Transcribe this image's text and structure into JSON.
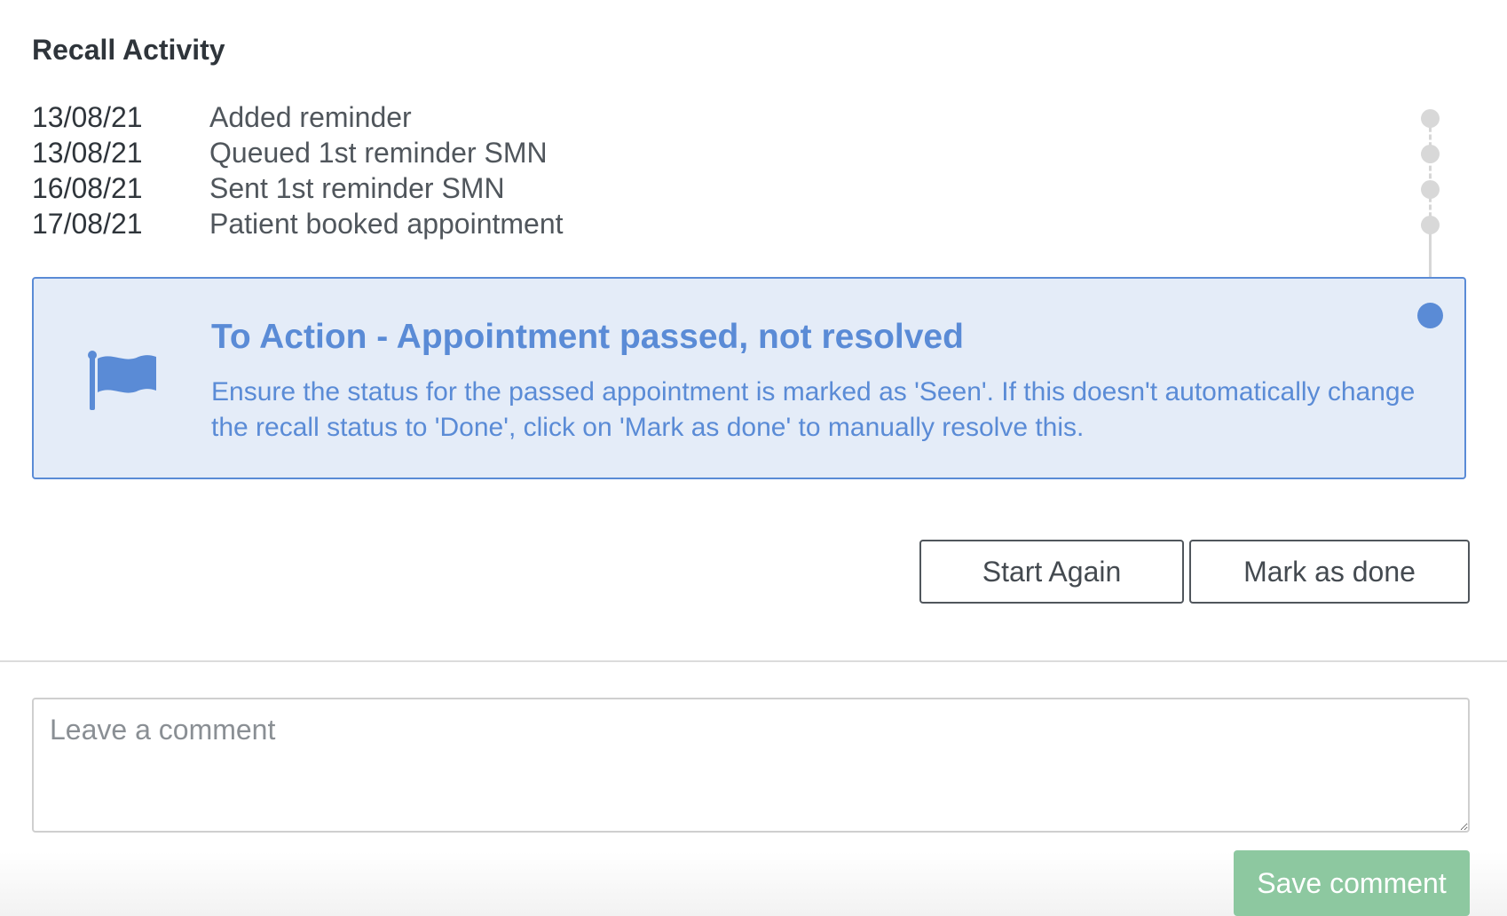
{
  "section": {
    "title": "Recall Activity"
  },
  "activity": [
    {
      "date": "13/08/21",
      "description": "Added reminder"
    },
    {
      "date": "13/08/21",
      "description": "Queued 1st reminder SMN"
    },
    {
      "date": "16/08/21",
      "description": "Sent 1st reminder SMN"
    },
    {
      "date": "17/08/21",
      "description": "Patient booked appointment"
    }
  ],
  "alert": {
    "icon": "flag-icon",
    "title": "To Action - Appointment passed, not resolved",
    "body": "Ensure the status for the passed appointment is marked as 'Seen'. If this doesn't automatically change the recall status to 'Done', click on 'Mark as done' to manually resolve this.",
    "color": "#5a8bd6",
    "background": "#e4ecf8"
  },
  "actions": {
    "start_again": "Start Again",
    "mark_done": "Mark as done"
  },
  "comment": {
    "placeholder": "Leave a comment",
    "value": "",
    "save_label": "Save comment",
    "save_color": "#8dc8a0"
  }
}
